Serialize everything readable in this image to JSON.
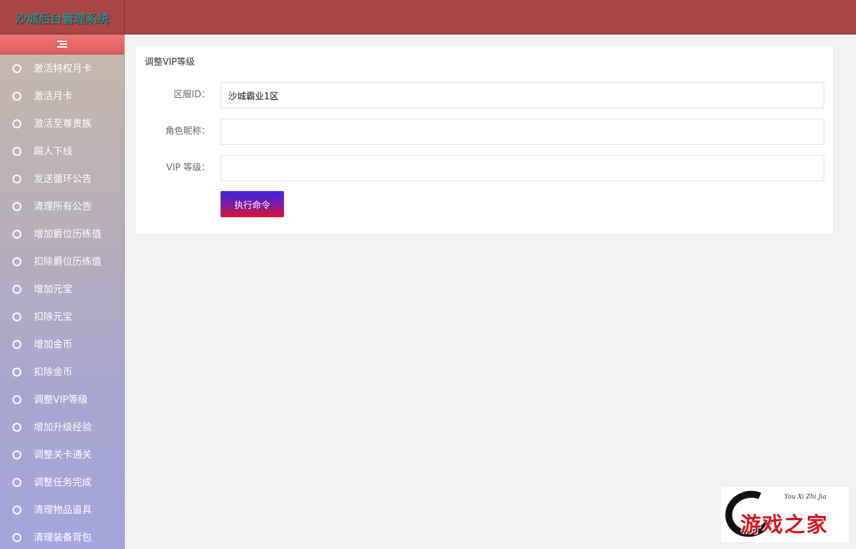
{
  "header": {
    "brand_title": "沙城后台管理系统"
  },
  "sidebar": {
    "items": [
      {
        "label": "激活特权月卡"
      },
      {
        "label": "激活月卡"
      },
      {
        "label": "激活至尊贵族"
      },
      {
        "label": "踢人下线"
      },
      {
        "label": "发送循环公告"
      },
      {
        "label": "清理所有公告"
      },
      {
        "label": "增加爵位历练值"
      },
      {
        "label": "扣除爵位历练值"
      },
      {
        "label": "增加元宝"
      },
      {
        "label": "扣除元宝"
      },
      {
        "label": "增加金币"
      },
      {
        "label": "扣除金币"
      },
      {
        "label": "调整VIP等级"
      },
      {
        "label": "增加升级经验"
      },
      {
        "label": "调整关卡通关"
      },
      {
        "label": "调整任务完成"
      },
      {
        "label": "清理物品道具"
      },
      {
        "label": "清理装备背包"
      }
    ]
  },
  "form": {
    "title": "调整VIP等级",
    "server_label": "区服ID：",
    "server_value": "沙城霸业1区",
    "nickname_label": "角色昵称：",
    "nickname_value": "",
    "vip_label": "VIP 等级：",
    "vip_value": "",
    "submit_label": "执行命令"
  },
  "watermark": {
    "script_text": "You Xi Zhi Jia",
    "main_text": "游戏之家"
  }
}
